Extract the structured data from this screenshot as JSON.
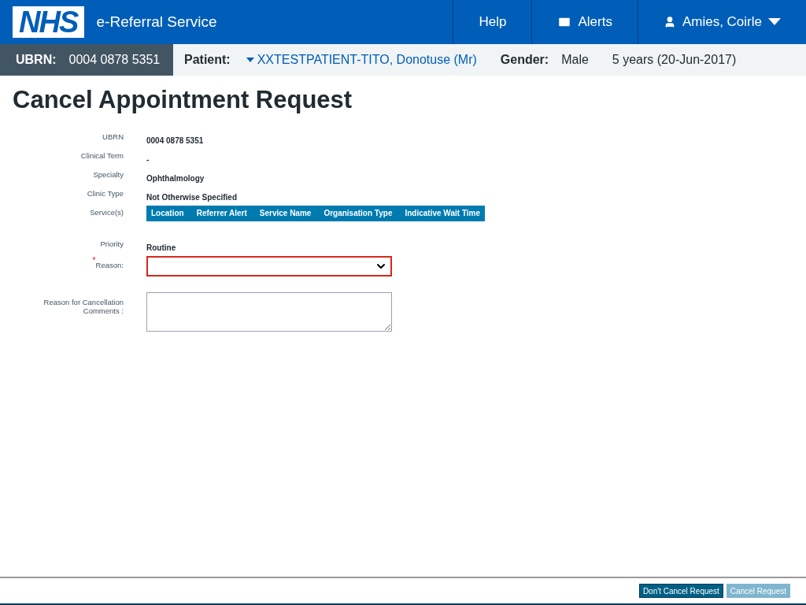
{
  "header": {
    "logo": "NHS",
    "service_name": "e-Referral Service",
    "nav": [
      {
        "kind": "link",
        "label": "Help"
      },
      {
        "kind": "alerts",
        "label": "Alerts"
      },
      {
        "kind": "user",
        "label": "Amies, Coirle"
      }
    ]
  },
  "patient_bar": {
    "ubrn_label": "UBRN:",
    "ubrn": "0004 0878 5351",
    "patient_label": "Patient:",
    "patient_name": "XXTESTPATIENT-TITO, Donotuse (Mr)",
    "gender_label": "Gender:",
    "gender": "Male",
    "age": "5 years (20-Jun-2017)"
  },
  "title": "Cancel Appointment Request",
  "fields": [
    {
      "kind": "text",
      "label": "UBRN",
      "value": "0004 0878 5351"
    },
    {
      "kind": "text",
      "label": "Clinical Term",
      "value": "-"
    },
    {
      "kind": "text",
      "label": "Specialty",
      "value": "Ophthalmology"
    },
    {
      "kind": "text",
      "label": "Clinic Type",
      "value": "Not Otherwise Specified"
    },
    {
      "kind": "table",
      "label": "Service(s)",
      "columns": [
        "Location",
        "Referrer Alert",
        "Service Name",
        "Organisation Type",
        "Indicative Wait Time"
      ]
    },
    {
      "kind": "text",
      "label": "Priority",
      "value": "Routine"
    },
    {
      "kind": "select",
      "label": "Reason:",
      "required_mark": "*",
      "error": true
    },
    {
      "kind": "textarea",
      "label": "Reason for Cancellation Comments :",
      "error": false
    }
  ],
  "buttons": [
    {
      "label": "Don't Cancel Request",
      "disabled": false
    },
    {
      "label": "Cancel Request",
      "disabled": true
    }
  ]
}
